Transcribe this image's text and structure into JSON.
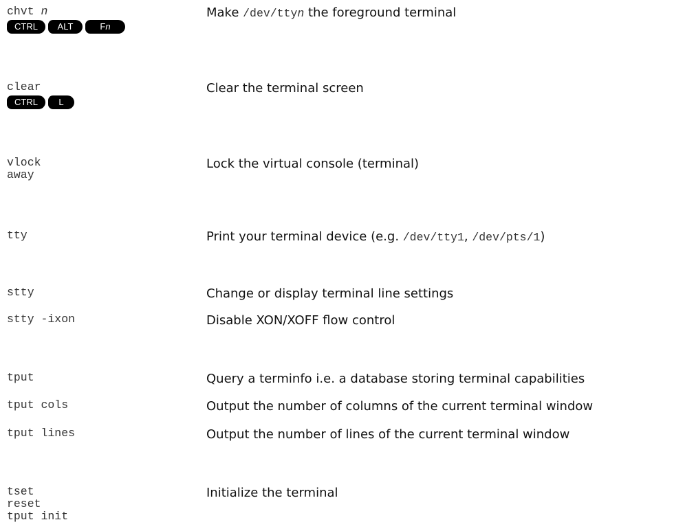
{
  "rows": [
    {
      "cmd": [
        "chvt ",
        "n"
      ],
      "keys": [
        "CTRL",
        "ALT",
        "F",
        "n"
      ],
      "desc": [
        "Make ",
        "/dev/tty",
        "n",
        " the foreground terminal"
      ]
    },
    {
      "cmd": [
        "clear"
      ],
      "keys": [
        "CTRL",
        "L"
      ],
      "desc": [
        "Clear the terminal screen"
      ]
    },
    {
      "cmd": [
        "vlock",
        "away"
      ],
      "desc": [
        "Lock the virtual console (terminal)"
      ]
    },
    {
      "cmd": [
        "tty"
      ],
      "desc": [
        "Print your terminal device (e.g. ",
        "/dev/tty1",
        ", ",
        "/dev/pts/1",
        ")"
      ]
    },
    {
      "cmd": [
        "stty"
      ],
      "desc": [
        "Change or display terminal line settings"
      ]
    },
    {
      "cmd": [
        "stty -ixon"
      ],
      "desc": [
        "Disable XON/XOFF flow control"
      ]
    },
    {
      "cmd": [
        "tput"
      ],
      "desc": [
        "Query a terminfo i.e. a database storing terminal capabilities"
      ]
    },
    {
      "cmd": [
        "tput cols"
      ],
      "desc": [
        "Output the number of columns of the current terminal window"
      ]
    },
    {
      "cmd": [
        "tput lines"
      ],
      "desc": [
        "Output the number of lines of the current terminal window"
      ]
    },
    {
      "cmd": [
        "tset",
        "reset",
        "tput init"
      ],
      "desc": [
        "Initialize the terminal"
      ]
    }
  ]
}
